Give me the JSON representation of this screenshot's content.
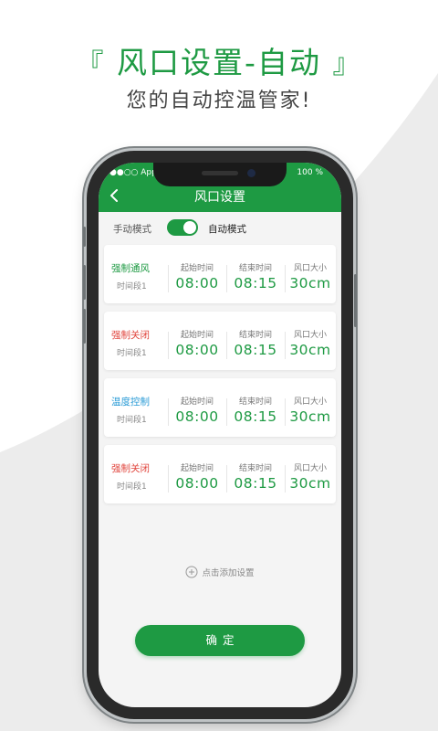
{
  "promo": {
    "bracket_left": "『",
    "title": "风口设置-自动",
    "bracket_right": "』",
    "subtitle": "您的自动控温管家!"
  },
  "status_bar": {
    "carrier": "●●○○ Applica",
    "battery": "100 %"
  },
  "app_bar": {
    "title": "风口设置",
    "back_icon": "chevron-left-icon"
  },
  "mode": {
    "manual_label": "手动模式",
    "auto_label": "自动模式",
    "auto_enabled": true
  },
  "columns": {
    "start": "起始时间",
    "end": "结束时间",
    "size": "风口大小"
  },
  "cards": [
    {
      "mode": "强制通风",
      "mode_color": "#1e9a43",
      "slot": "时间段1",
      "start": "08:00",
      "end": "08:15",
      "size": "30cm"
    },
    {
      "mode": "强制关闭",
      "mode_color": "#e0443c",
      "slot": "时间段1",
      "start": "08:00",
      "end": "08:15",
      "size": "30cm"
    },
    {
      "mode": "温度控制",
      "mode_color": "#2a9bd6",
      "slot": "时间段1",
      "start": "08:00",
      "end": "08:15",
      "size": "30cm"
    },
    {
      "mode": "强制关闭",
      "mode_color": "#e0443c",
      "slot": "时间段1",
      "start": "08:00",
      "end": "08:15",
      "size": "30cm"
    }
  ],
  "add_setting": {
    "label": "点击添加设置",
    "icon": "plus-circle-icon"
  },
  "confirm": {
    "label": "确定"
  },
  "colors": {
    "accent": "#1e9a43"
  }
}
